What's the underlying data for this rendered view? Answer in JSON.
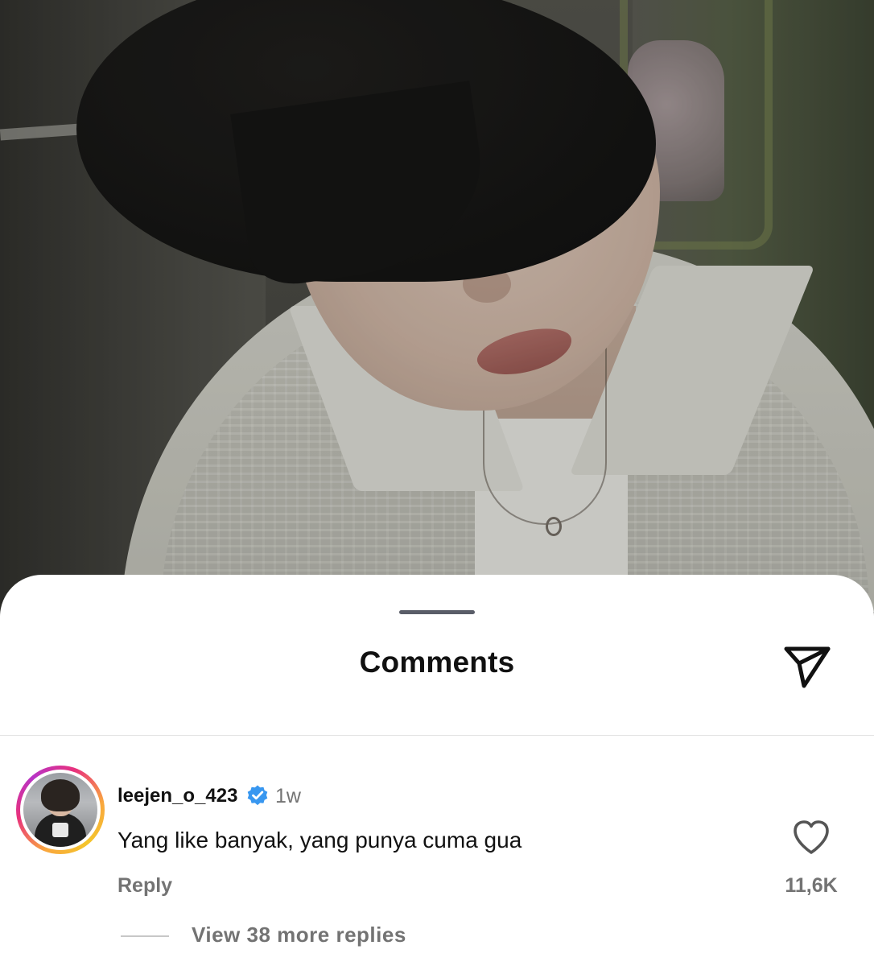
{
  "sheet": {
    "title": "Comments",
    "share_icon": "send-icon"
  },
  "comment": {
    "username": "leejen_o_423",
    "verified_icon": "verified-badge-icon",
    "time": "1w",
    "text": "Yang like banyak, yang punya cuma gua",
    "reply_label": "Reply",
    "like_icon": "heart-icon",
    "like_count": "11,6K",
    "view_replies_label": "View 38 more replies"
  },
  "colors": {
    "verified_blue": "#3897f0",
    "text_primary": "#111111",
    "text_secondary": "#737373"
  }
}
